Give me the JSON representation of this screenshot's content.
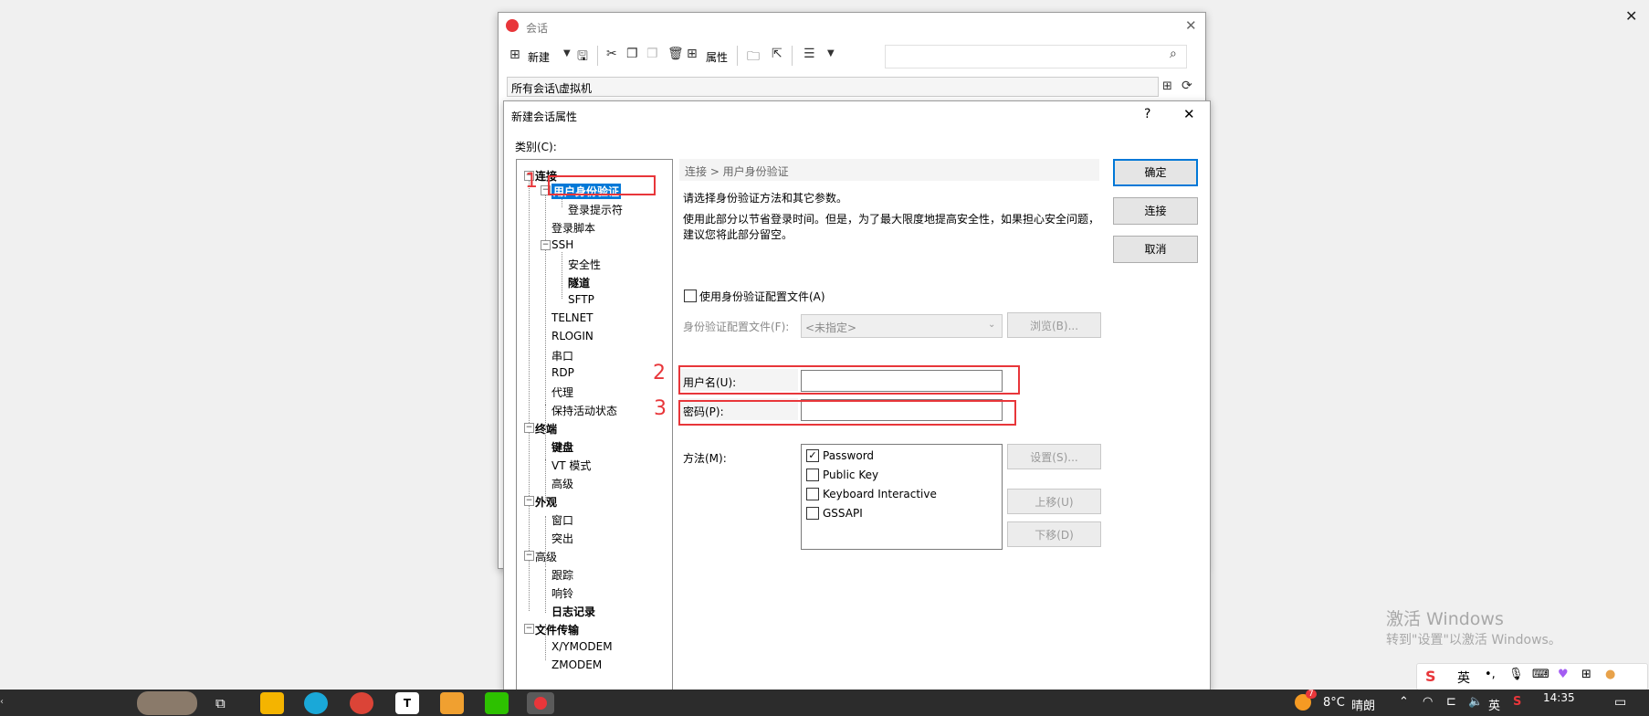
{
  "outer_window": {
    "title": "会话",
    "toolbar": {
      "new_label": "新建",
      "properties_label": "属性"
    },
    "path": "所有会话\\虚拟机"
  },
  "dialog": {
    "title": "新建会话属性",
    "help": "?",
    "close": "✕",
    "category_label": "类别(C):",
    "tree": [
      {
        "label": "连接",
        "bold": true
      },
      {
        "label": "用户身份验证",
        "bold": true,
        "selected": true
      },
      {
        "label": "登录提示符"
      },
      {
        "label": "登录脚本"
      },
      {
        "label": "SSH"
      },
      {
        "label": "安全性"
      },
      {
        "label": "隧道",
        "bold": true
      },
      {
        "label": "SFTP"
      },
      {
        "label": "TELNET"
      },
      {
        "label": "RLOGIN"
      },
      {
        "label": "串口"
      },
      {
        "label": "RDP"
      },
      {
        "label": "代理"
      },
      {
        "label": "保持活动状态"
      },
      {
        "label": "终端",
        "bold": true
      },
      {
        "label": "键盘",
        "bold": true
      },
      {
        "label": "VT 模式"
      },
      {
        "label": "高级"
      },
      {
        "label": "外观",
        "bold": true
      },
      {
        "label": "窗口"
      },
      {
        "label": "突出"
      },
      {
        "label": "高级"
      },
      {
        "label": "跟踪"
      },
      {
        "label": "响铃"
      },
      {
        "label": "日志记录",
        "bold": true
      },
      {
        "label": "文件传输",
        "bold": true
      },
      {
        "label": "X/YMODEM"
      },
      {
        "label": "ZMODEM"
      }
    ],
    "breadcrumb": "连接 > 用户身份验证",
    "desc1": "请选择身份验证方法和其它参数。",
    "desc2": "使用此部分以节省登录时间。但是，为了最大限度地提高安全性，如果担心安全问题，",
    "desc3": "建议您将此部分留空。",
    "use_profile_label": "使用身份验证配置文件(A)",
    "profile_file_label": "身份验证配置文件(F):",
    "profile_select_value": "<未指定>",
    "browse_button": "浏览(B)...",
    "username_label": "用户名(U):",
    "username_value": "",
    "password_label": "密码(P):",
    "password_value": "",
    "method_label": "方法(M):",
    "methods": [
      {
        "label": "Password",
        "checked": true
      },
      {
        "label": "Public Key",
        "checked": false
      },
      {
        "label": "Keyboard Interactive",
        "checked": false
      },
      {
        "label": "GSSAPI",
        "checked": false
      }
    ],
    "settings_button": "设置(S)...",
    "move_up_button": "上移(U)",
    "move_down_button": "下移(D)",
    "ok_button": "确定",
    "connect_button": "连接",
    "cancel_button": "取消"
  },
  "annotations": [
    "1",
    "2",
    "3"
  ],
  "activate_windows": {
    "title": "激活 Windows",
    "subtitle": "转到\"设置\"以激活 Windows。"
  },
  "ime_bar": {
    "lang": "英"
  },
  "taskbar": {
    "weather_temp": "8°C",
    "weather_text": "晴朗",
    "weather_badge": "7",
    "lang": "英",
    "time": "14:35"
  },
  "colors": {
    "accent": "#0078d7",
    "annotation_red": "#e8363a",
    "selection_blue": "#0078d7",
    "taskbar": "#2c2c2c"
  }
}
